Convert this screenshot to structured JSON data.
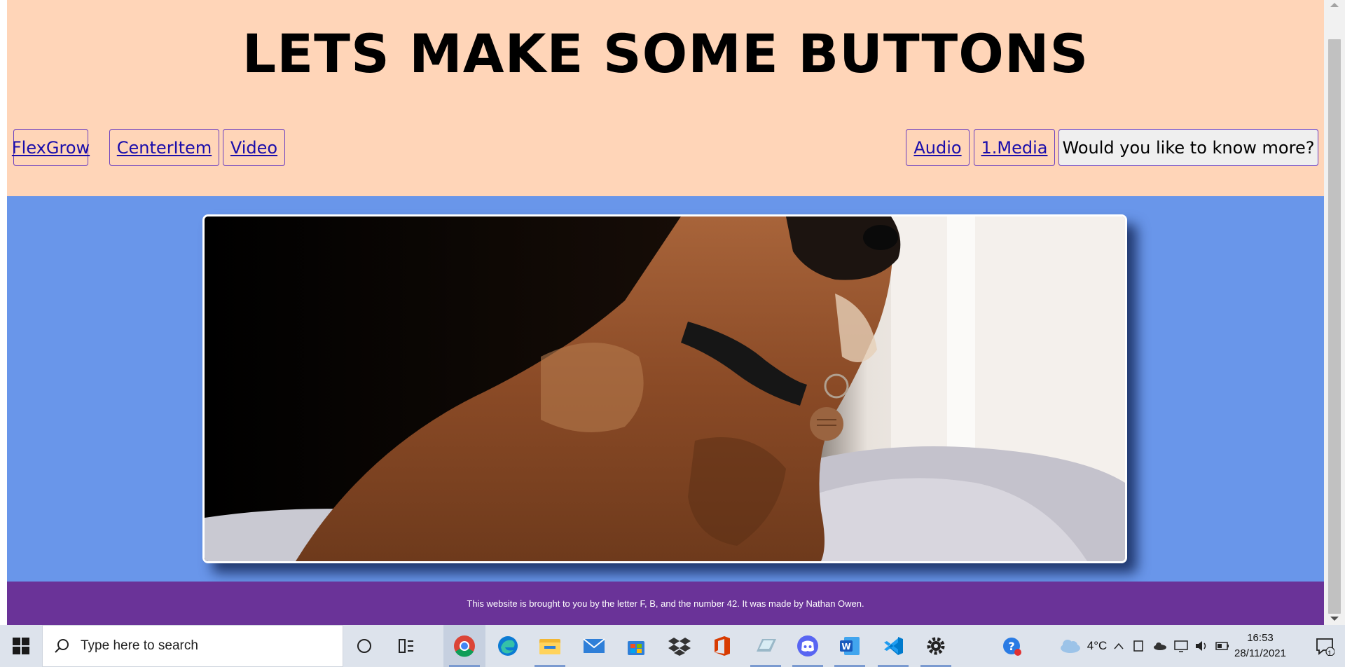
{
  "header": {
    "title": "LETS MAKE SOME BUTTONS"
  },
  "nav": {
    "left": [
      "FlexGrow",
      "CenterItem",
      "Video"
    ],
    "right": [
      "Audio",
      "1.Media"
    ],
    "more_button": "Would you like to know more?"
  },
  "main": {
    "image_subject": "dog photo"
  },
  "footer": {
    "text": "This website is brought to you by the letter F, B, and the number 42. It was made by Nathan Owen."
  },
  "taskbar": {
    "search_placeholder": "Type here to search",
    "apps": [
      "cortana-icon",
      "task-view-icon",
      "chrome-icon",
      "edge-icon",
      "file-explorer-icon",
      "mail-icon",
      "store-icon",
      "dropbox-icon",
      "office-icon",
      "notes-icon",
      "discord-icon",
      "word-icon",
      "vscode-icon",
      "settings-icon"
    ],
    "weather": "4°C",
    "time": "16:53",
    "date": "28/11/2021",
    "notification_count": "1"
  },
  "colors": {
    "header_bg": "#ffd5b8",
    "main_bg": "#6996ea",
    "footer_bg": "#6a3398",
    "link": "#1a0dab"
  }
}
